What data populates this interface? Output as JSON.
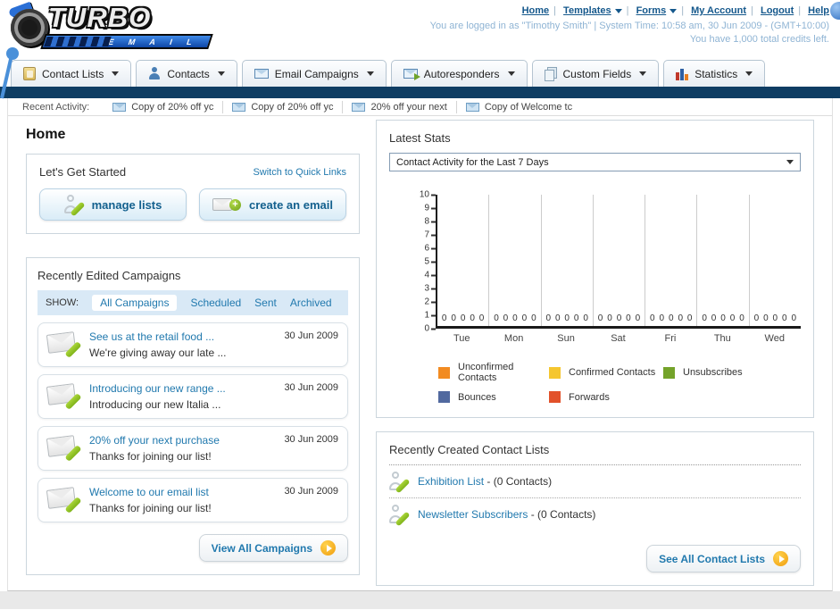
{
  "header": {
    "brand": {
      "name": "TURBO",
      "sub": "E M A I L"
    },
    "nav_links": [
      {
        "label": "Home"
      },
      {
        "label": "Templates"
      },
      {
        "label": "Forms"
      },
      {
        "label": "My Account"
      },
      {
        "label": "Logout"
      },
      {
        "label": "Help"
      }
    ],
    "login_line": "You are logged in as \"Timothy Smith\" | System Time: 10:58 am, 30 Jun 2009 - (GMT+10:00)",
    "credits_line": "You have 1,000 total credits left."
  },
  "nav_tabs": [
    {
      "label": "Contact Lists"
    },
    {
      "label": "Contacts"
    },
    {
      "label": "Email Campaigns"
    },
    {
      "label": "Autoresponders"
    },
    {
      "label": "Custom Fields"
    },
    {
      "label": "Statistics"
    }
  ],
  "recent_activity": {
    "label": "Recent Activity:",
    "items": [
      {
        "label": "Copy of 20% off yc"
      },
      {
        "label": "Copy of 20% off yc"
      },
      {
        "label": "20% off your next"
      },
      {
        "label": "Copy of Welcome tc"
      }
    ]
  },
  "home": {
    "title": "Home"
  },
  "get_started": {
    "title": "Let's Get Started",
    "switch_link": "Switch to Quick Links",
    "buttons": [
      {
        "label": "manage lists"
      },
      {
        "label": "create an email"
      }
    ]
  },
  "campaigns": {
    "title": "Recently Edited Campaigns",
    "show_label": "SHOW:",
    "filters": [
      {
        "label": "All Campaigns"
      },
      {
        "label": "Scheduled"
      },
      {
        "label": "Sent"
      },
      {
        "label": "Archived"
      }
    ],
    "items": [
      {
        "title": "See us at the retail food ...",
        "subtitle": "We're giving away our late ...",
        "date": "30 Jun 2009"
      },
      {
        "title": "Introducing our new range ...",
        "subtitle": "Introducing our new Italia ...",
        "date": "30 Jun 2009"
      },
      {
        "title": "20% off your next purchase",
        "subtitle": "Thanks for joining our list!",
        "date": "30 Jun 2009"
      },
      {
        "title": "Welcome to our email list",
        "subtitle": "Thanks for joining our list!",
        "date": "30 Jun 2009"
      }
    ],
    "view_all_label": "View All Campaigns"
  },
  "stats": {
    "title": "Latest Stats",
    "dropdown_value": "Contact Activity for the Last 7 Days"
  },
  "chart_data": {
    "type": "bar",
    "title": "Contact Activity for the Last 7 Days",
    "categories": [
      "Tue",
      "Mon",
      "Sun",
      "Sat",
      "Fri",
      "Thu",
      "Wed"
    ],
    "series": [
      {
        "name": "Unconfirmed Contacts",
        "color": "#f28b21",
        "values": [
          0,
          0,
          0,
          0,
          0,
          0,
          0
        ]
      },
      {
        "name": "Confirmed Contacts",
        "color": "#f5c62f",
        "values": [
          0,
          0,
          0,
          0,
          0,
          0,
          0
        ]
      },
      {
        "name": "Unsubscribes",
        "color": "#74a32a",
        "values": [
          0,
          0,
          0,
          0,
          0,
          0,
          0
        ]
      },
      {
        "name": "Bounces",
        "color": "#51699f",
        "values": [
          0,
          0,
          0,
          0,
          0,
          0,
          0
        ]
      },
      {
        "name": "Forwards",
        "color": "#e2512a",
        "values": [
          0,
          0,
          0,
          0,
          0,
          0,
          0
        ]
      }
    ],
    "ylim": [
      0,
      10
    ],
    "yticks": [
      0,
      1,
      2,
      3,
      4,
      5,
      6,
      7,
      8,
      9,
      10
    ],
    "grid": "vertical",
    "legend_position": "bottom"
  },
  "contact_lists": {
    "title": "Recently Created Contact Lists",
    "items": [
      {
        "name": "Exhibition List",
        "suffix": " - (0 Contacts)"
      },
      {
        "name": "Newsletter Subscribers",
        "suffix": " - (0 Contacts)"
      }
    ],
    "see_all_label": "See All Contact Lists"
  }
}
